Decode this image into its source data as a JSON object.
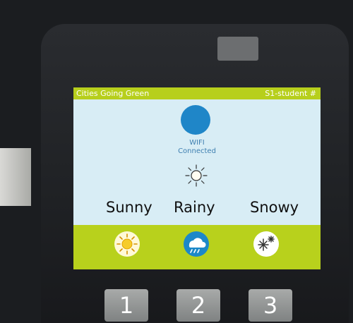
{
  "statusbar": {
    "title": "Cities Going Green",
    "user": "S1-student #"
  },
  "wifi": {
    "label": "WIFI",
    "status": "Connected",
    "color": "#1f86c8"
  },
  "current_weather": {
    "icon": "sun-icon"
  },
  "weather_options": [
    {
      "label": "Sunny",
      "icon": "sun-icon"
    },
    {
      "label": "Rainy",
      "icon": "rain-cloud-icon"
    },
    {
      "label": "Snowy",
      "icon": "snowflake-icon"
    }
  ],
  "hardware_buttons": [
    "1",
    "2",
    "3"
  ],
  "colors": {
    "accent": "#b8d11c",
    "screen_bg": "#d8edf5",
    "text_blue": "#3e7fb0"
  }
}
